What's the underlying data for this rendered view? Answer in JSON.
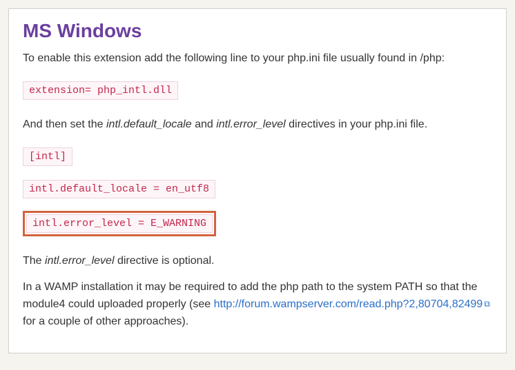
{
  "heading": "MS Windows",
  "para1": "To enable this extension add the following line to your php.ini file usually found in /php:",
  "code1": "extension= php_intl.dll",
  "para2_a": "And then set the ",
  "para2_em1": "intl.default_locale",
  "para2_b": " and ",
  "para2_em2": "intl.error_level",
  "para2_c": " directives in your php.ini file.",
  "code2": "[intl]",
  "code3": "intl.default_locale = en_utf8",
  "code4": "intl.error_level = E_WARNING",
  "para3_a": "The ",
  "para3_em": "intl.error_level",
  "para3_b": " directive is optional.",
  "para4_a": "In a WAMP installation it may be required to add the php path to the system PATH so that the module4 could uploaded properly (see ",
  "para4_link": "http://forum.wampserver.com/read.php?2,80704,82499",
  "para4_b": " for a couple of other approaches).",
  "ext_icon_glyph": "⧉"
}
